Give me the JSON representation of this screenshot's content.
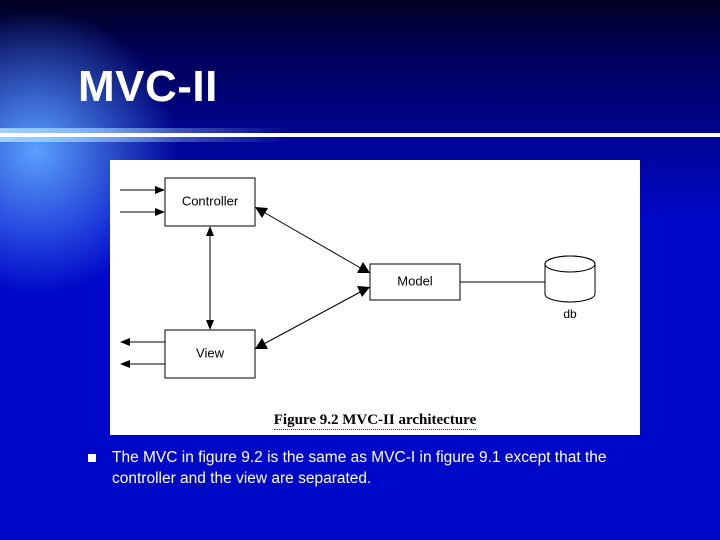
{
  "title": "MVC-II",
  "diagram": {
    "boxes": {
      "controller": "Controller",
      "view": "View",
      "model": "Model"
    },
    "db_label": "db",
    "caption": "Figure 9.2 MVC-II architecture"
  },
  "body_text": "The MVC in figure 9.2 is the same as MVC-I in figure 9.1 except that the controller and the view are separated."
}
